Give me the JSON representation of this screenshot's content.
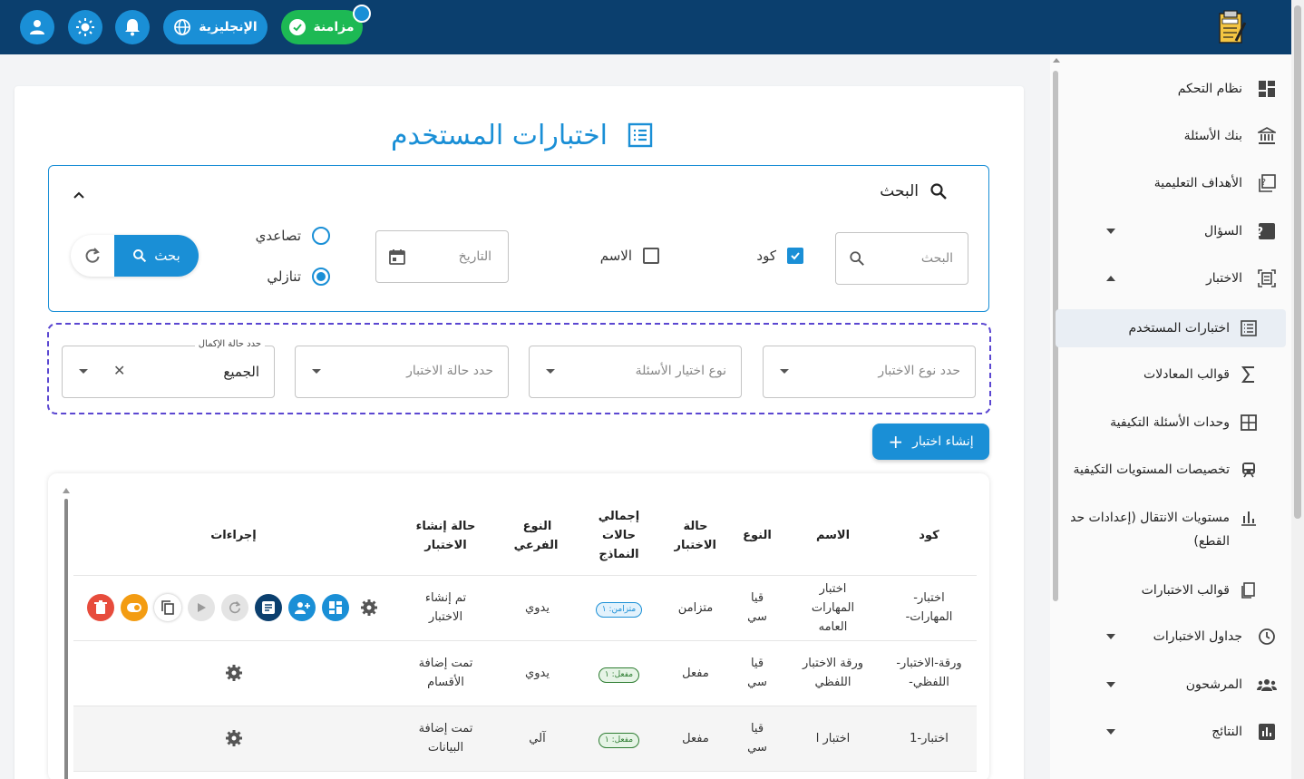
{
  "topbar": {
    "sync_label": "مزامنة",
    "language_label": "الإنجليزية",
    "colors": {
      "bar": "#0b3f6e",
      "accent": "#1a8fd6",
      "sync": "#1db954"
    }
  },
  "sidebar": {
    "items": [
      {
        "label": "نظام التحكم",
        "icon": "dashboard-icon"
      },
      {
        "label": "بنك الأسئلة",
        "icon": "bank-icon"
      },
      {
        "label": "الأهداف التعليمية",
        "icon": "quiz-icon"
      },
      {
        "label": "السؤال",
        "icon": "question-icon"
      },
      {
        "label": "الاختبار",
        "icon": "exam-icon"
      },
      {
        "label": "اختبارات المستخدم",
        "icon": "list-icon"
      },
      {
        "label": "قوالب المعادلات",
        "icon": "sigma-icon"
      },
      {
        "label": "وحدات الأسئلة التكيفية",
        "icon": "grid-icon"
      },
      {
        "label": "تخصيصات المستويات التكيفية",
        "icon": "train-icon"
      },
      {
        "label": "مستويات الانتقال (إعدادات حد القطع)",
        "icon": "bar-chart-icon"
      },
      {
        "label": "قوالب الاختبارات",
        "icon": "template-icon"
      },
      {
        "label": "جداول الاختبارات",
        "icon": "clock-icon"
      },
      {
        "label": "المرشحون",
        "icon": "people-icon"
      },
      {
        "label": "النتائج",
        "icon": "results-icon"
      }
    ]
  },
  "page": {
    "title": "اختبارات المستخدم"
  },
  "search": {
    "heading": "البحث",
    "input_placeholder": "البحث",
    "code_label": "كود",
    "name_label": "الاسم",
    "date_placeholder": "التاريخ",
    "asc_label": "تصاعدي",
    "desc_label": "تنازلي",
    "button_label": "بحث"
  },
  "filters": {
    "exam_type": "حدد نوع الاختبار",
    "question_type": "نوع اختيار الأسئلة",
    "exam_status": "حدد حالة الاختبار",
    "completion_label": "حدد حالة الإكمال",
    "completion_value": "الجميع"
  },
  "create_button": "إنشاء اختبار",
  "table": {
    "headers": [
      "كود",
      "الاسم",
      "النوع",
      "حالة الاختبار",
      "إجمالي حالات النماذج",
      "النوع الفرعي",
      "حالة إنشاء الاختبار",
      "إجراءات"
    ],
    "rows": [
      {
        "code": "اختبار-المهارات-",
        "name": "اختبار المهارات العامه",
        "type": "قيا سي",
        "status": "متزامن",
        "badge": "متزامن: ١",
        "badge_kind": "sync",
        "subtype": "يدوي",
        "creation": "تم إنشاء الاختبار"
      },
      {
        "code": "ورقة-الاختبار-اللفظي-",
        "name": "ورقة الاختبار اللفظي",
        "type": "قيا سي",
        "status": "مفعل",
        "badge": "مفعل: ١",
        "badge_kind": "on",
        "subtype": "يدوي",
        "creation": "تمت إضافة الأقسام"
      },
      {
        "code": "اختبار-1",
        "name": "اختبار ا",
        "type": "قيا سي",
        "status": "مفعل",
        "badge": "مفعل: ١",
        "badge_kind": "on",
        "subtype": "آلي",
        "creation": "تمت إضافة البيانات"
      }
    ]
  }
}
